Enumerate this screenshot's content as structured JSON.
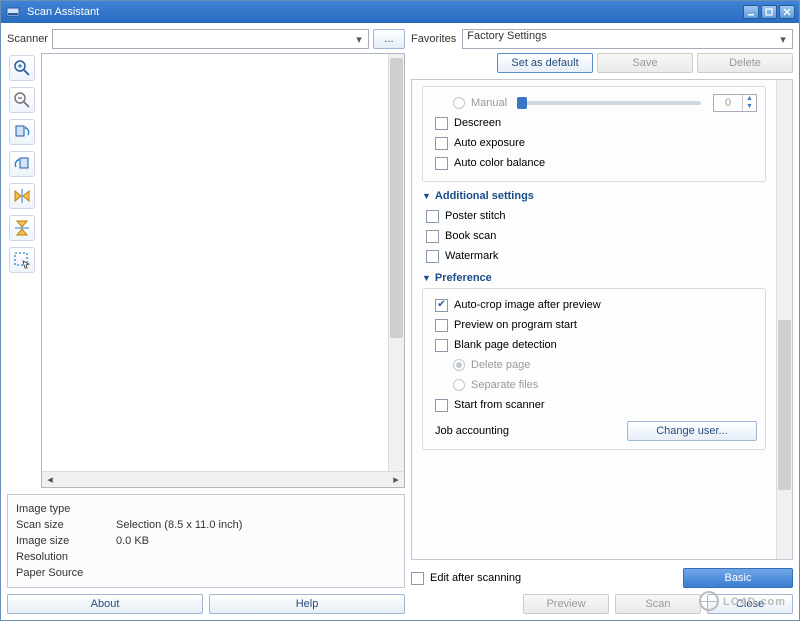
{
  "window": {
    "title": "Scan Assistant"
  },
  "left": {
    "scanner_label": "Scanner",
    "scanner_value": "",
    "browse_label": "...",
    "tools": [
      "zoom-in",
      "zoom-out",
      "rotate-left",
      "rotate-right",
      "mirror-h",
      "mirror-v",
      "select-area"
    ],
    "info": {
      "image_type_k": "Image type",
      "image_type_v": "",
      "scan_size_k": "Scan size",
      "scan_size_v": "Selection (8.5 x 11.0 inch)",
      "image_size_k": "Image size",
      "image_size_v": "0.0 KB",
      "resolution_k": "Resolution",
      "resolution_v": "",
      "paper_source_k": "Paper Source",
      "paper_source_v": ""
    },
    "about": "About",
    "help": "Help"
  },
  "right": {
    "favorites_label": "Favorites",
    "favorites_value": "Factory Settings",
    "set_default": "Set as default",
    "save": "Save",
    "delete": "Delete",
    "manual_label": "Manual",
    "manual_value": "0",
    "descreen": "Descreen",
    "auto_exposure": "Auto exposure",
    "auto_color_balance": "Auto color balance",
    "sec_additional": "Additional settings",
    "poster_stitch": "Poster stitch",
    "book_scan": "Book scan",
    "watermark_opt": "Watermark",
    "sec_preference": "Preference",
    "auto_crop": "Auto-crop image after preview",
    "preview_start": "Preview on program start",
    "blank_page": "Blank page detection",
    "delete_page": "Delete page",
    "separate_files": "Separate files",
    "start_from_scanner": "Start from scanner",
    "job_accounting": "Job accounting",
    "change_user": "Change user...",
    "edit_after": "Edit after scanning",
    "basic": "Basic",
    "preview_btn": "Preview",
    "scan_btn": "Scan",
    "close_btn": "Close"
  },
  "watermark": "LO4D.com"
}
